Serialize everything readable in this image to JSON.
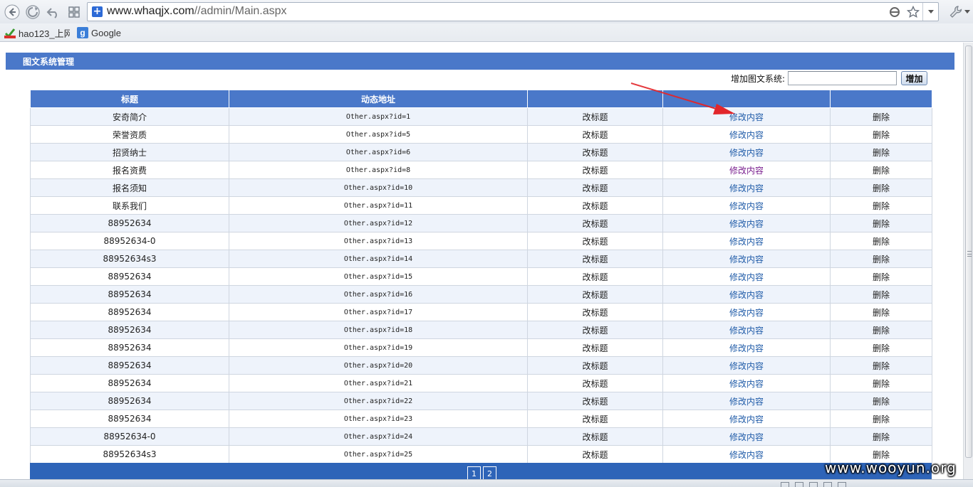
{
  "browser": {
    "url_host": "www.whaqjx.com",
    "url_path": "//admin/Main.aspx",
    "bookmarks": [
      {
        "label": "hao123_上网"
      },
      {
        "label": "Google"
      }
    ]
  },
  "page": {
    "title": "图文系统管理",
    "add": {
      "label": "增加图文系统:",
      "input_value": "",
      "button_label": "增加"
    },
    "table": {
      "headers": [
        "标题",
        "动态地址",
        "",
        "",
        ""
      ],
      "action_edit_title": "改标题",
      "action_edit_content": "修改内容",
      "action_delete": "删除",
      "rows": [
        {
          "title": "安奇简介",
          "url": "Other.aspx?id=1"
        },
        {
          "title": "荣誉资质",
          "url": "Other.aspx?id=5"
        },
        {
          "title": "招贤纳士",
          "url": "Other.aspx?id=6"
        },
        {
          "title": "报名资费",
          "url": "Other.aspx?id=8",
          "visited": true
        },
        {
          "title": "报名须知",
          "url": "Other.aspx?id=10"
        },
        {
          "title": "联系我们",
          "url": "Other.aspx?id=11"
        },
        {
          "title": "88952634",
          "url": "Other.aspx?id=12"
        },
        {
          "title": "88952634-0",
          "url": "Other.aspx?id=13"
        },
        {
          "title": "88952634s3",
          "url": "Other.aspx?id=14"
        },
        {
          "title": "88952634",
          "url": "Other.aspx?id=15"
        },
        {
          "title": "88952634",
          "url": "Other.aspx?id=16"
        },
        {
          "title": "88952634",
          "url": "Other.aspx?id=17"
        },
        {
          "title": "88952634",
          "url": "Other.aspx?id=18"
        },
        {
          "title": "88952634",
          "url": "Other.aspx?id=19"
        },
        {
          "title": "88952634",
          "url": "Other.aspx?id=20"
        },
        {
          "title": "88952634",
          "url": "Other.aspx?id=21"
        },
        {
          "title": "88952634",
          "url": "Other.aspx?id=22"
        },
        {
          "title": "88952634",
          "url": "Other.aspx?id=23"
        },
        {
          "title": "88952634-0",
          "url": "Other.aspx?id=24"
        },
        {
          "title": "88952634s3",
          "url": "Other.aspx?id=25"
        }
      ]
    },
    "pager": [
      "1",
      "2"
    ]
  },
  "watermark": "www.wooyun.org",
  "colors": {
    "header_blue": "#4a78c9",
    "pager_blue": "#2e64b8",
    "link": "#1f5ba8",
    "link_visited": "#7a1f8f",
    "annotation_arrow": "#e2262b"
  },
  "icons": {
    "back": "back-arrow-icon",
    "forward": "forward-arrow-icon",
    "reload": "reload-icon",
    "apps": "apps-grid-icon",
    "page": "page-icon",
    "bookmark": "star-icon",
    "tools": "wrench-icon"
  }
}
